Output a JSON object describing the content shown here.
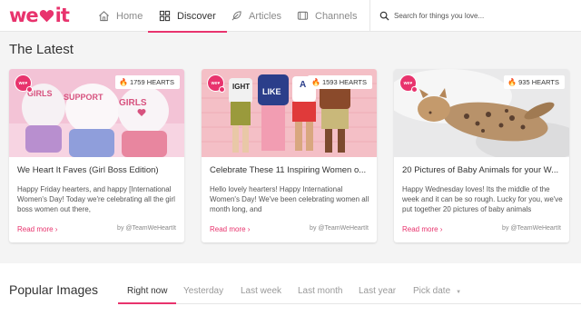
{
  "nav": {
    "logo": {
      "text_left": "we",
      "text_right": "it"
    },
    "items": [
      {
        "label": "Home",
        "icon": "home-icon"
      },
      {
        "label": "Discover",
        "icon": "grid-icon",
        "active": true
      },
      {
        "label": "Articles",
        "icon": "feather-icon"
      },
      {
        "label": "Channels",
        "icon": "tv-icon"
      }
    ],
    "search_placeholder": "Search for things you love..."
  },
  "latest": {
    "title": "The Latest",
    "cards": [
      {
        "avatar": "we♥",
        "hearts": "1759 HEARTS",
        "title": "We Heart It Faves (Girl Boss Edition)",
        "text": "Happy Friday hearters, and happy [International Women's Day! Today we're celebrating all the girl boss women out there,",
        "read_more": "Read more ›",
        "by": "by @TeamWeHeartIt",
        "image_words": [
          "GIRLS",
          "SUPPORT",
          "GIRLS"
        ]
      },
      {
        "avatar": "we♥",
        "hearts": "1593 HEARTS",
        "title": "Celebrate These 11 Inspiring Women o...",
        "text": "Hello lovely hearters! Happy International Women's Day! We've been celebrating women all month long, and",
        "read_more": "Read more ›",
        "by": "by @TeamWeHeartIt",
        "image_words": [
          "IGHT",
          "LIKE",
          "A"
        ]
      },
      {
        "avatar": "we♥",
        "hearts": "935 HEARTS",
        "title": "20 Pictures of Baby Animals for your W...",
        "text": "Happy Wednesday loves! Its the middle of the week and it can be so rough. Lucky for you, we've put together 20 pictures of baby animals",
        "read_more": "Read more ›",
        "by": "by @TeamWeHeartIt"
      }
    ]
  },
  "popular": {
    "title": "Popular Images",
    "filters": [
      "Right now",
      "Yesterday",
      "Last week",
      "Last month",
      "Last year",
      "Pick date"
    ],
    "active_filter": "Right now"
  },
  "colors": {
    "accent": "#e8336d",
    "flame": "#f0781e"
  }
}
